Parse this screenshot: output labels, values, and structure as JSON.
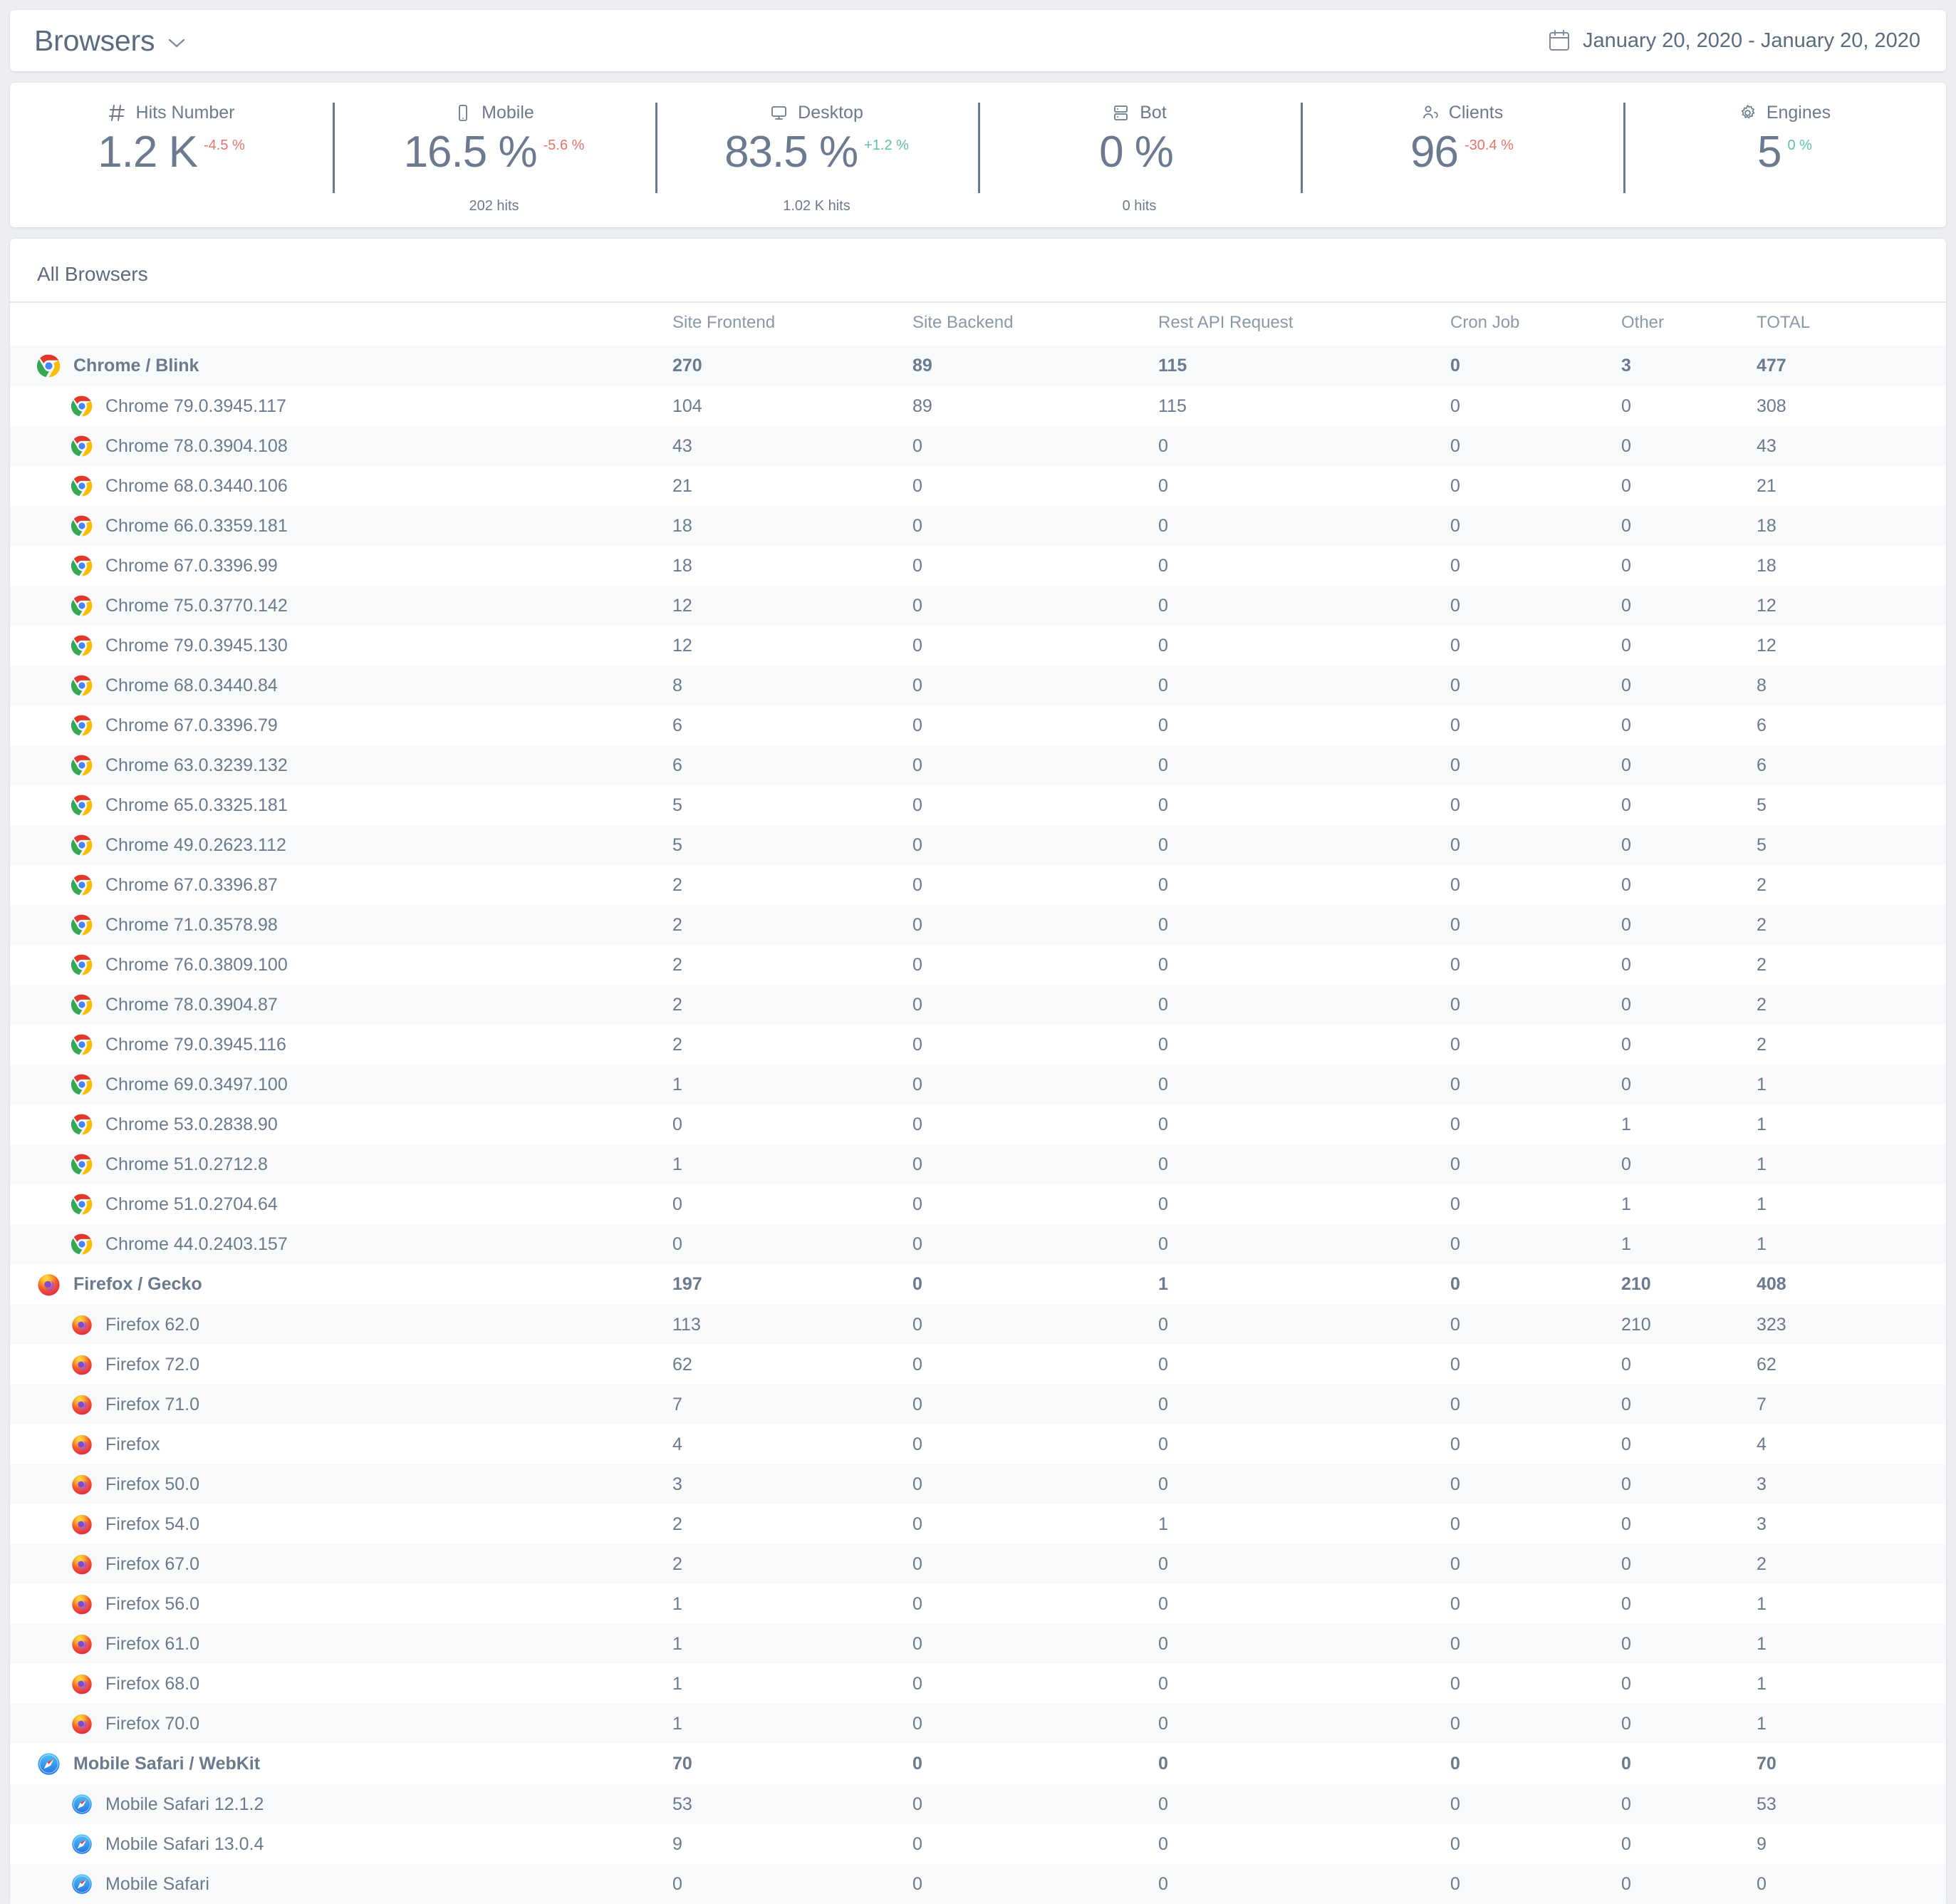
{
  "header": {
    "title": "Browsers",
    "dropdown_icon": "chevron-down-icon",
    "date_range": "January 20, 2020 - January 20, 2020",
    "calendar_icon": "calendar-icon"
  },
  "kpis": [
    {
      "icon": "hash-icon",
      "label": "Hits Number",
      "value": "1.2 K",
      "delta": "-4.5 %",
      "delta_dir": "neg",
      "sub": ""
    },
    {
      "icon": "mobile-icon",
      "label": "Mobile",
      "value": "16.5 %",
      "delta": "-5.6 %",
      "delta_dir": "neg",
      "sub": "202  hits"
    },
    {
      "icon": "desktop-icon",
      "label": "Desktop",
      "value": "83.5 %",
      "delta": "+1.2 %",
      "delta_dir": "pos",
      "sub": "1.02 K hits"
    },
    {
      "icon": "bot-icon",
      "label": "Bot",
      "value": "0 %",
      "delta": "",
      "delta_dir": "neg",
      "sub": "0  hits"
    },
    {
      "icon": "clients-icon",
      "label": "Clients",
      "value": "96",
      "delta": "-30.4 %",
      "delta_dir": "neg",
      "sub": ""
    },
    {
      "icon": "gear-icon",
      "label": "Engines",
      "value": "5",
      "delta": "0 %",
      "delta_dir": "pos",
      "sub": ""
    }
  ],
  "table": {
    "title": "All Browsers",
    "columns": [
      "",
      "Site Frontend",
      "Site Backend",
      "Rest API Request",
      "Cron Job",
      "Other",
      "TOTAL"
    ],
    "rows": [
      {
        "type": "group",
        "icon": "chrome-icon",
        "name": "Chrome / Blink",
        "values": [
          "270",
          "89",
          "115",
          "0",
          "3",
          "477"
        ]
      },
      {
        "type": "child",
        "icon": "chrome-icon",
        "name": "Chrome 79.0.3945.117",
        "values": [
          "104",
          "89",
          "115",
          "0",
          "0",
          "308"
        ]
      },
      {
        "type": "child",
        "icon": "chrome-icon",
        "name": "Chrome 78.0.3904.108",
        "values": [
          "43",
          "0",
          "0",
          "0",
          "0",
          "43"
        ]
      },
      {
        "type": "child",
        "icon": "chrome-icon",
        "name": "Chrome 68.0.3440.106",
        "values": [
          "21",
          "0",
          "0",
          "0",
          "0",
          "21"
        ]
      },
      {
        "type": "child",
        "icon": "chrome-icon",
        "name": "Chrome 66.0.3359.181",
        "values": [
          "18",
          "0",
          "0",
          "0",
          "0",
          "18"
        ]
      },
      {
        "type": "child",
        "icon": "chrome-icon",
        "name": "Chrome 67.0.3396.99",
        "values": [
          "18",
          "0",
          "0",
          "0",
          "0",
          "18"
        ]
      },
      {
        "type": "child",
        "icon": "chrome-icon",
        "name": "Chrome 75.0.3770.142",
        "values": [
          "12",
          "0",
          "0",
          "0",
          "0",
          "12"
        ]
      },
      {
        "type": "child",
        "icon": "chrome-icon",
        "name": "Chrome 79.0.3945.130",
        "values": [
          "12",
          "0",
          "0",
          "0",
          "0",
          "12"
        ]
      },
      {
        "type": "child",
        "icon": "chrome-icon",
        "name": "Chrome 68.0.3440.84",
        "values": [
          "8",
          "0",
          "0",
          "0",
          "0",
          "8"
        ]
      },
      {
        "type": "child",
        "icon": "chrome-icon",
        "name": "Chrome 67.0.3396.79",
        "values": [
          "6",
          "0",
          "0",
          "0",
          "0",
          "6"
        ]
      },
      {
        "type": "child",
        "icon": "chrome-icon",
        "name": "Chrome 63.0.3239.132",
        "values": [
          "6",
          "0",
          "0",
          "0",
          "0",
          "6"
        ]
      },
      {
        "type": "child",
        "icon": "chrome-icon",
        "name": "Chrome 65.0.3325.181",
        "values": [
          "5",
          "0",
          "0",
          "0",
          "0",
          "5"
        ]
      },
      {
        "type": "child",
        "icon": "chrome-icon",
        "name": "Chrome 49.0.2623.112",
        "values": [
          "5",
          "0",
          "0",
          "0",
          "0",
          "5"
        ]
      },
      {
        "type": "child",
        "icon": "chrome-icon",
        "name": "Chrome 67.0.3396.87",
        "values": [
          "2",
          "0",
          "0",
          "0",
          "0",
          "2"
        ]
      },
      {
        "type": "child",
        "icon": "chrome-icon",
        "name": "Chrome 71.0.3578.98",
        "values": [
          "2",
          "0",
          "0",
          "0",
          "0",
          "2"
        ]
      },
      {
        "type": "child",
        "icon": "chrome-icon",
        "name": "Chrome 76.0.3809.100",
        "values": [
          "2",
          "0",
          "0",
          "0",
          "0",
          "2"
        ]
      },
      {
        "type": "child",
        "icon": "chrome-icon",
        "name": "Chrome 78.0.3904.87",
        "values": [
          "2",
          "0",
          "0",
          "0",
          "0",
          "2"
        ]
      },
      {
        "type": "child",
        "icon": "chrome-icon",
        "name": "Chrome 79.0.3945.116",
        "values": [
          "2",
          "0",
          "0",
          "0",
          "0",
          "2"
        ]
      },
      {
        "type": "child",
        "icon": "chrome-icon",
        "name": "Chrome 69.0.3497.100",
        "values": [
          "1",
          "0",
          "0",
          "0",
          "0",
          "1"
        ]
      },
      {
        "type": "child",
        "icon": "chrome-icon",
        "name": "Chrome 53.0.2838.90",
        "values": [
          "0",
          "0",
          "0",
          "0",
          "1",
          "1"
        ]
      },
      {
        "type": "child",
        "icon": "chrome-icon",
        "name": "Chrome 51.0.2712.8",
        "values": [
          "1",
          "0",
          "0",
          "0",
          "0",
          "1"
        ]
      },
      {
        "type": "child",
        "icon": "chrome-icon",
        "name": "Chrome 51.0.2704.64",
        "values": [
          "0",
          "0",
          "0",
          "0",
          "1",
          "1"
        ]
      },
      {
        "type": "child",
        "icon": "chrome-icon",
        "name": "Chrome 44.0.2403.157",
        "values": [
          "0",
          "0",
          "0",
          "0",
          "1",
          "1"
        ]
      },
      {
        "type": "group",
        "icon": "firefox-icon",
        "name": "Firefox / Gecko",
        "values": [
          "197",
          "0",
          "1",
          "0",
          "210",
          "408"
        ]
      },
      {
        "type": "child",
        "icon": "firefox-icon",
        "name": "Firefox 62.0",
        "values": [
          "113",
          "0",
          "0",
          "0",
          "210",
          "323"
        ]
      },
      {
        "type": "child",
        "icon": "firefox-icon",
        "name": "Firefox 72.0",
        "values": [
          "62",
          "0",
          "0",
          "0",
          "0",
          "62"
        ]
      },
      {
        "type": "child",
        "icon": "firefox-icon",
        "name": "Firefox 71.0",
        "values": [
          "7",
          "0",
          "0",
          "0",
          "0",
          "7"
        ]
      },
      {
        "type": "child",
        "icon": "firefox-icon",
        "name": "Firefox",
        "values": [
          "4",
          "0",
          "0",
          "0",
          "0",
          "4"
        ]
      },
      {
        "type": "child",
        "icon": "firefox-icon",
        "name": "Firefox 50.0",
        "values": [
          "3",
          "0",
          "0",
          "0",
          "0",
          "3"
        ]
      },
      {
        "type": "child",
        "icon": "firefox-icon",
        "name": "Firefox 54.0",
        "values": [
          "2",
          "0",
          "1",
          "0",
          "0",
          "3"
        ]
      },
      {
        "type": "child",
        "icon": "firefox-icon",
        "name": "Firefox 67.0",
        "values": [
          "2",
          "0",
          "0",
          "0",
          "0",
          "2"
        ]
      },
      {
        "type": "child",
        "icon": "firefox-icon",
        "name": "Firefox 56.0",
        "values": [
          "1",
          "0",
          "0",
          "0",
          "0",
          "1"
        ]
      },
      {
        "type": "child",
        "icon": "firefox-icon",
        "name": "Firefox 61.0",
        "values": [
          "1",
          "0",
          "0",
          "0",
          "0",
          "1"
        ]
      },
      {
        "type": "child",
        "icon": "firefox-icon",
        "name": "Firefox 68.0",
        "values": [
          "1",
          "0",
          "0",
          "0",
          "0",
          "1"
        ]
      },
      {
        "type": "child",
        "icon": "firefox-icon",
        "name": "Firefox 70.0",
        "values": [
          "1",
          "0",
          "0",
          "0",
          "0",
          "1"
        ]
      },
      {
        "type": "group",
        "icon": "safari-icon",
        "name": "Mobile Safari / WebKit",
        "values": [
          "70",
          "0",
          "0",
          "0",
          "0",
          "70"
        ]
      },
      {
        "type": "child",
        "icon": "safari-icon",
        "name": "Mobile Safari 12.1.2",
        "values": [
          "53",
          "0",
          "0",
          "0",
          "0",
          "53"
        ]
      },
      {
        "type": "child",
        "icon": "safari-icon",
        "name": "Mobile Safari 13.0.4",
        "values": [
          "9",
          "0",
          "0",
          "0",
          "0",
          "9"
        ]
      },
      {
        "type": "child",
        "icon": "safari-icon",
        "name": "Mobile Safari",
        "values": [
          "0",
          "0",
          "0",
          "0",
          "0",
          "0"
        ],
        "clipped": true
      }
    ]
  }
}
